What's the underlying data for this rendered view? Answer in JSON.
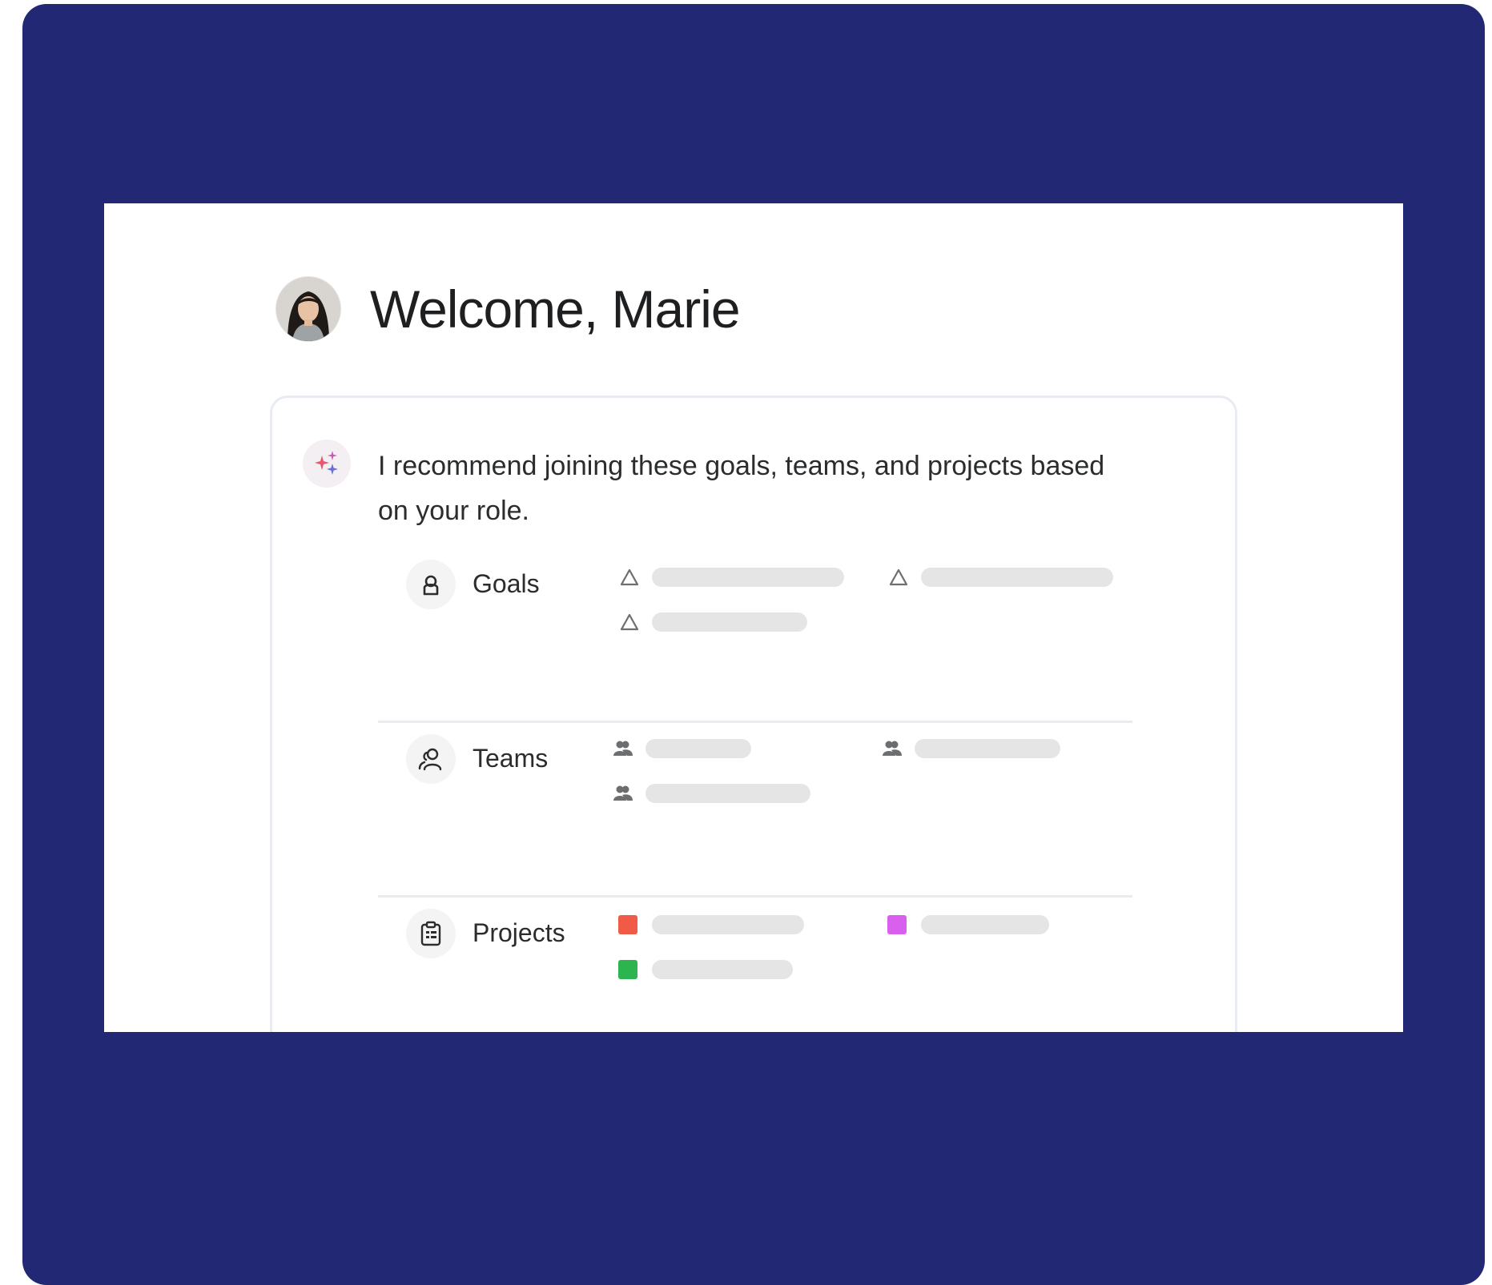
{
  "welcome": {
    "title": "Welcome, Marie"
  },
  "assistant": {
    "message": "I recommend joining these goals, teams, and projects based on your role."
  },
  "sections": {
    "goals": {
      "label": "Goals",
      "icon": "goal-person-icon",
      "item_icon": "triangle-outline-icon"
    },
    "teams": {
      "label": "Teams",
      "icon": "team-outline-icon",
      "item_icon": "team-filled-icon"
    },
    "projects": {
      "label": "Projects",
      "icon": "clipboard-icon",
      "colors": [
        "#f05a46",
        "#d960ee",
        "#2cb54e"
      ]
    }
  },
  "colors": {
    "frame": "#222873",
    "placeholder": "#e5e5e6"
  }
}
